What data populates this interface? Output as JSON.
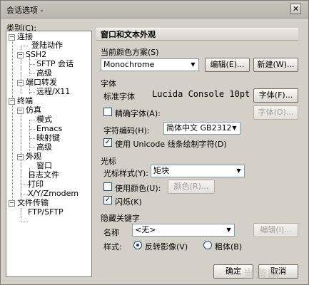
{
  "window": {
    "title": "会话选项 -",
    "close_label": "✕"
  },
  "category_label": "类别(C):",
  "tree": {
    "items": [
      {
        "label": "连接",
        "level": 0,
        "expanded": true
      },
      {
        "label": "登陆动作",
        "level": 1
      },
      {
        "label": "SSH2",
        "level": 1,
        "expanded": true
      },
      {
        "label": "SFTP 会话",
        "level": 2
      },
      {
        "label": "高级",
        "level": 2
      },
      {
        "label": "端口转发",
        "level": 1,
        "expanded": true
      },
      {
        "label": "远程/X11",
        "level": 2
      },
      {
        "label": "终端",
        "level": 0,
        "expanded": true
      },
      {
        "label": "仿真",
        "level": 1,
        "expanded": true
      },
      {
        "label": "模式",
        "level": 2
      },
      {
        "label": "Emacs",
        "level": 2
      },
      {
        "label": "映射键",
        "level": 2
      },
      {
        "label": "高级",
        "level": 2
      },
      {
        "label": "外观",
        "level": 1,
        "expanded": true
      },
      {
        "label": "窗口",
        "level": 2
      },
      {
        "label": "日志文件",
        "level": 1
      },
      {
        "label": "打印",
        "level": 1
      },
      {
        "label": "X/Y/Zmodem",
        "level": 1
      },
      {
        "label": "文件传输",
        "level": 0,
        "expanded": true
      },
      {
        "label": "FTP/SFTP",
        "level": 1
      }
    ]
  },
  "header": "窗口和文本外观",
  "color_scheme": {
    "label": "当前颜色方案(S)",
    "value": "Monochrome",
    "edit_button": "编辑(E)...",
    "new_button": "新建(W)..."
  },
  "font": {
    "section": "字体",
    "standard_label": "标准字体",
    "standard_preview": "Lucida Console 10pt",
    "font_button": "字体(F)...",
    "precise_label": "精确字体(A):",
    "precise_checked": false,
    "precise_button": "字体(O)...",
    "encoding_label": "字符编码(H):",
    "encoding_value": "简体中文 GB2312",
    "unicode_label": "使用 Unicode 线条绘制字符(D)",
    "unicode_checked": true
  },
  "cursor": {
    "section": "光标",
    "style_label": "光标样式(Y):",
    "style_value": "矩块",
    "use_color_label": "使用颜色(U):",
    "use_color_checked": false,
    "color_button": "颜色(R)...",
    "blink_label": "闪烁(K)",
    "blink_checked": true
  },
  "hotkeys": {
    "section": "隐藏关键字",
    "name_label": "名称",
    "name_value": "<无>",
    "edit_button": "编辑(I)...",
    "style_label": "样式:",
    "option_reverse": "反转影像(V)",
    "option_bold": "粗体(B)",
    "selected": "反转影像(V)"
  },
  "buttons": {
    "ok": "确定",
    "cancel": "取消"
  },
  "watermark": "当游网"
}
